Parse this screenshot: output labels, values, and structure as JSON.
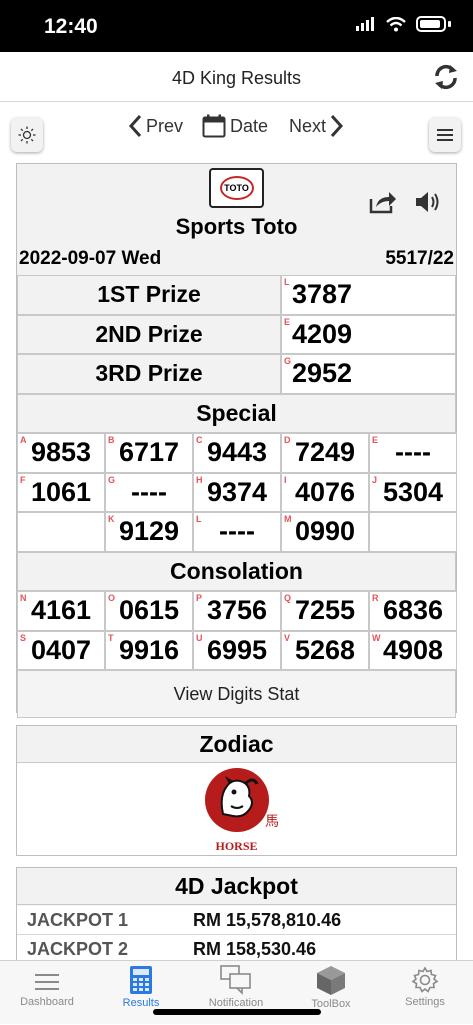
{
  "status": {
    "time": "12:40"
  },
  "nav": {
    "title": "4D King Results"
  },
  "toolbar": {
    "prev": "Prev",
    "date": "Date",
    "next": "Next"
  },
  "result": {
    "operator": "Sports Toto",
    "logo_text": "TOTO",
    "date": "2022-09-07 Wed",
    "draw_no": "5517/22",
    "prizes": [
      {
        "label": "1ST Prize",
        "tag": "L",
        "number": "3787"
      },
      {
        "label": "2ND Prize",
        "tag": "E",
        "number": "4209"
      },
      {
        "label": "3RD Prize",
        "tag": "G",
        "number": "2952"
      }
    ],
    "special_title": "Special",
    "special": [
      [
        {
          "tag": "A",
          "number": "9853"
        },
        {
          "tag": "B",
          "number": "6717"
        },
        {
          "tag": "C",
          "number": "9443"
        },
        {
          "tag": "D",
          "number": "7249"
        },
        {
          "tag": "E",
          "number": "----"
        }
      ],
      [
        {
          "tag": "F",
          "number": "1061"
        },
        {
          "tag": "G",
          "number": "----"
        },
        {
          "tag": "H",
          "number": "9374"
        },
        {
          "tag": "I",
          "number": "4076"
        },
        {
          "tag": "J",
          "number": "5304"
        }
      ],
      [
        {
          "tag": "",
          "number": ""
        },
        {
          "tag": "K",
          "number": "9129"
        },
        {
          "tag": "L",
          "number": "----"
        },
        {
          "tag": "M",
          "number": "0990"
        },
        {
          "tag": "",
          "number": ""
        }
      ]
    ],
    "consolation_title": "Consolation",
    "consolation": [
      [
        {
          "tag": "N",
          "number": "4161"
        },
        {
          "tag": "O",
          "number": "0615"
        },
        {
          "tag": "P",
          "number": "3756"
        },
        {
          "tag": "Q",
          "number": "7255"
        },
        {
          "tag": "R",
          "number": "6836"
        }
      ],
      [
        {
          "tag": "S",
          "number": "0407"
        },
        {
          "tag": "T",
          "number": "9916"
        },
        {
          "tag": "U",
          "number": "6995"
        },
        {
          "tag": "V",
          "number": "5268"
        },
        {
          "tag": "W",
          "number": "4908"
        }
      ]
    ],
    "stat_button": "View Digits Stat"
  },
  "zodiac": {
    "title": "Zodiac",
    "name": "HORSE",
    "char": "馬"
  },
  "jackpot": {
    "title": "4D Jackpot",
    "rows": [
      {
        "label": "JACKPOT 1",
        "amount": "RM 15,578,810.46"
      },
      {
        "label": "JACKPOT 2",
        "amount": "RM 158,530.46"
      }
    ]
  },
  "tabs": [
    {
      "label": "Dashboard",
      "icon": "dashboard-icon"
    },
    {
      "label": "Results",
      "icon": "calculator-icon",
      "active": true
    },
    {
      "label": "Notification",
      "icon": "chat-icon"
    },
    {
      "label": "ToolBox",
      "icon": "box-icon"
    },
    {
      "label": "Settings",
      "icon": "gear-icon"
    }
  ],
  "colors": {
    "accent": "#2a7ae2",
    "tag_red": "#e2555a",
    "zodiac_red": "#b71c1c"
  }
}
